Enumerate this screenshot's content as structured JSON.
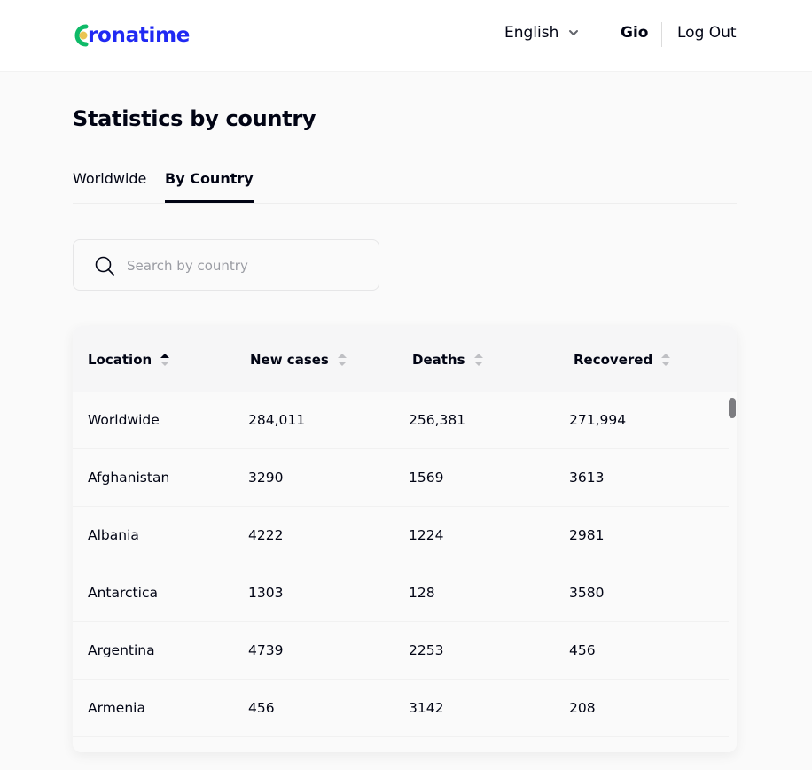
{
  "header": {
    "logo_text": "ronatime",
    "language": "English",
    "user": "Gio",
    "logout": "Log Out"
  },
  "page": {
    "title": "Statistics by country",
    "tabs": [
      {
        "label": "Worldwide",
        "active": false
      },
      {
        "label": "By Country",
        "active": true
      }
    ],
    "search_placeholder": "Search by country"
  },
  "table": {
    "columns": [
      "Location",
      "New cases",
      "Deaths",
      "Recovered"
    ],
    "sorted_column": "Location",
    "rows": [
      [
        "Worldwide",
        "284,011",
        "256,381",
        "271,994"
      ],
      [
        "Afghanistan",
        "3290",
        "1569",
        "3613"
      ],
      [
        "Albania",
        "4222",
        "1224",
        "2981"
      ],
      [
        "Antarctica",
        "1303",
        "128",
        "3580"
      ],
      [
        "Argentina",
        "4739",
        "2253",
        "456"
      ],
      [
        "Armenia",
        "456",
        "3142",
        "208"
      ]
    ]
  },
  "colors": {
    "brand_blue": "#2029f3",
    "brand_green": "#0fba68",
    "brand_yellow": "#eac451",
    "text": "#010414"
  }
}
